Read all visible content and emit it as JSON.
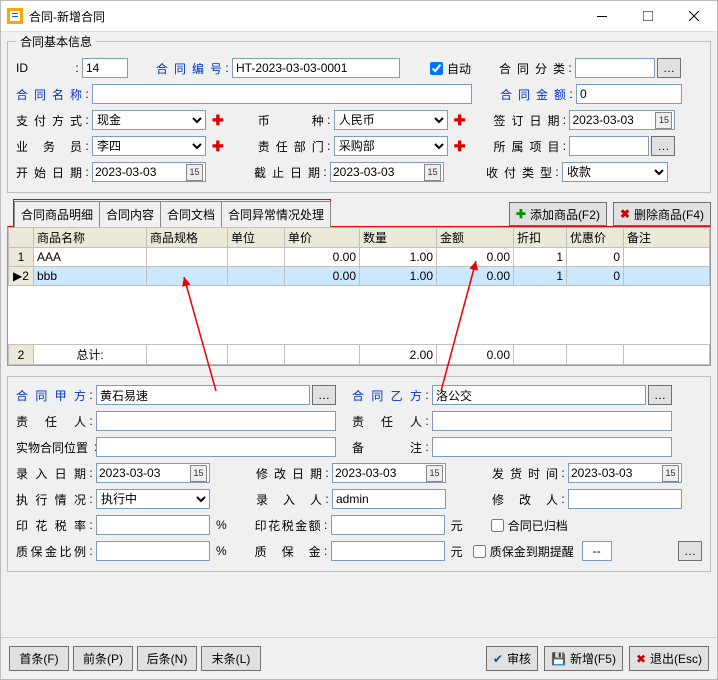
{
  "title": "合同-新增合同",
  "group1_legend": "合同基本信息",
  "id_label": "ID",
  "id_value": "14",
  "code_label": "合同编号",
  "code_value": "HT-2023-03-03-0001",
  "auto_label": "自动",
  "auto_checked": true,
  "category_label": "合同分类",
  "name_label": "合同名称",
  "amount_label": "合同金额",
  "amount_value": "0",
  "pay_label": "支付方式",
  "pay_value": "现金",
  "currency_label": "币　　种",
  "currency_value": "人民币",
  "sign_label": "签订日期",
  "sign_value": "2023-03-03",
  "sales_label": "业 务 员",
  "sales_value": "李四",
  "dept_label": "责任部门",
  "dept_value": "采购部",
  "project_label": "所属项目",
  "start_label": "开始日期",
  "start_value": "2023-03-03",
  "end_label": "截止日期",
  "end_value": "2023-03-03",
  "rptype_label": "收付类型",
  "rptype_value": "收款",
  "tabs": [
    "合同商品明细",
    "合同内容",
    "合同文档",
    "合同异常情况处理"
  ],
  "btn_add": "添加商品(F2)",
  "btn_del": "删除商品(F4)",
  "cols": [
    "商品名称",
    "商品规格",
    "单位",
    "单价",
    "数量",
    "金额",
    "折扣",
    "优惠价",
    "备注"
  ],
  "rows": [
    {
      "n": "1",
      "name": "AAA",
      "spec": "",
      "unit": "",
      "price": "0.00",
      "qty": "1.00",
      "amount": "0.00",
      "disc": "1",
      "promo": "0",
      "memo": ""
    },
    {
      "n": "2",
      "name": "bbb",
      "spec": "",
      "unit": "",
      "price": "0.00",
      "qty": "1.00",
      "amount": "0.00",
      "disc": "1",
      "promo": "0",
      "memo": "",
      "hl": true
    }
  ],
  "total_label": "总计:",
  "total_count": "2",
  "total_qty": "2.00",
  "total_amount": "0.00",
  "partyA_label": "合同甲方",
  "partyA_value": "黄石易速",
  "partyB_label": "合同乙方",
  "partyB_value": "洛公交",
  "respA_label": "责 任 人",
  "respB_label": "责 任 人",
  "loc_label": "实物合同位置",
  "remark_label": "备　　注",
  "input_date_label": "录入日期",
  "input_date_value": "2023-03-03",
  "modify_date_label": "修改日期",
  "modify_date_value": "2023-03-03",
  "ship_date_label": "发货时间",
  "ship_date_value": "2023-03-03",
  "exec_label": "执行情况",
  "exec_value": "执行中",
  "entry_label": "录 入 人",
  "entry_value": "admin",
  "modifier_label": "修 改 人",
  "stamp_rate_label": "印花税率",
  "pct": "%",
  "stamp_amount_label": "印花税金额",
  "yuan": "元",
  "archived_label": "合同已归档",
  "margin_rate_label": "质保金比例",
  "margin_label": "质 保 金",
  "margin_remind_label": "质保金到期提醒",
  "margin_remind_value": "--",
  "nav": {
    "first": "首条(F)",
    "prev": "前条(P)",
    "next": "后条(N)",
    "last": "末条(L)"
  },
  "audit": "审核",
  "new": "新增(F5)",
  "exit": "退出(Esc)"
}
